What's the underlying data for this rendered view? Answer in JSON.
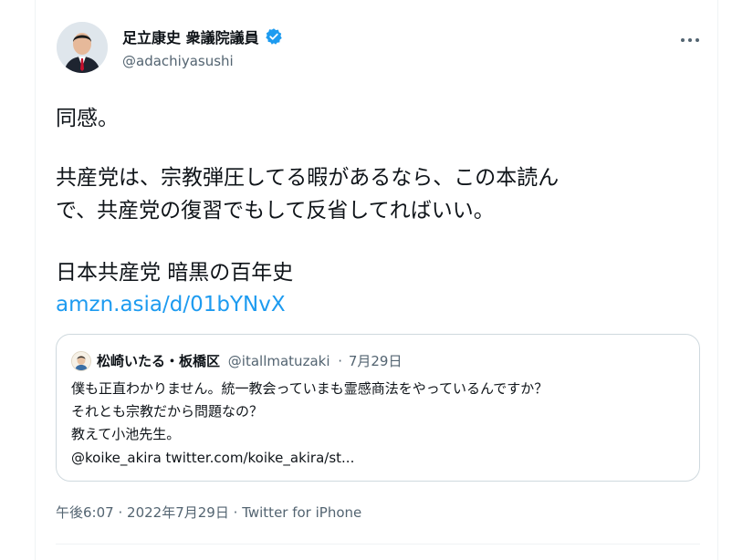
{
  "author": {
    "name": "足立康史 衆議院議員",
    "handle": "@adachiyasushi",
    "verified": true
  },
  "tweet": {
    "line1": "同感。",
    "line2": "共産党は、宗教弾圧してる暇があるなら、この本読ん",
    "line3": "で、共産党の復習でもして反省してればいい。",
    "line4": "日本共産党 暗黒の百年史",
    "link": "amzn.asia/d/01bYNvX"
  },
  "quoted_tweet": {
    "name": "松崎いたる・板橋区",
    "handle": "@itallmatuzaki",
    "separator": "·",
    "date": "7月29日",
    "line1": "僕も正直わかりません。統一教会っていまも霊感商法をやっているんですか？",
    "line2": "それとも宗教だから問題なの？",
    "line3": "教えて小池先生。",
    "line4": "@koike_akira twitter.com/koike_akira/st..."
  },
  "footer": {
    "time": "午後6:07",
    "sep1": "·",
    "date": "2022年7月29日",
    "sep2": "·",
    "source": "Twitter for iPhone"
  },
  "colors": {
    "text": "#0f1419",
    "secondary": "#536471",
    "link": "#1d9bf0",
    "border": "#cfd9de"
  },
  "icons": [
    "verified-badge-icon",
    "more-options-icon"
  ]
}
